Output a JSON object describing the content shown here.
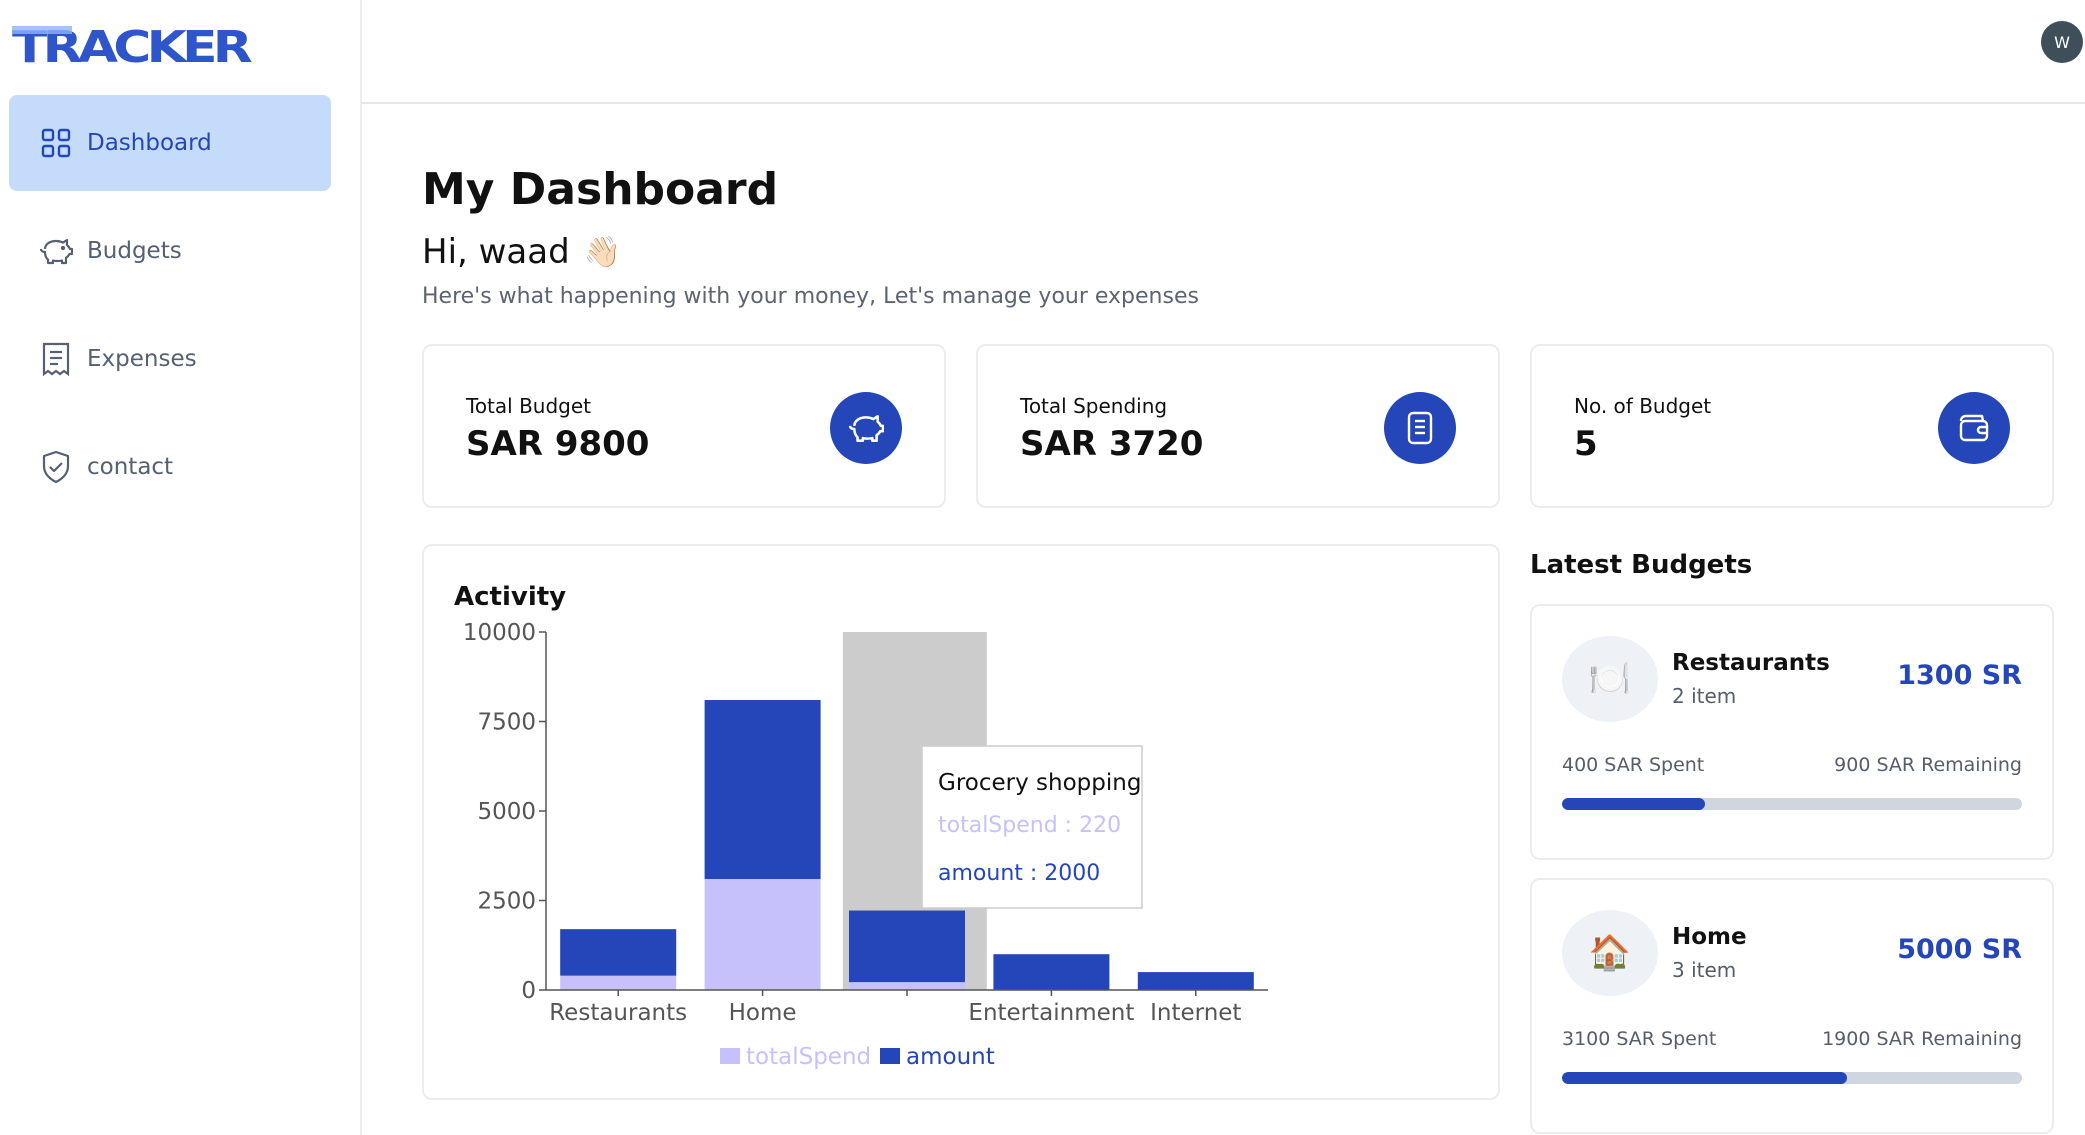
{
  "app": {
    "logo_text": "TRACKER"
  },
  "sidebar": {
    "items": [
      {
        "label": "Dashboard",
        "icon": "grid-icon",
        "active": true
      },
      {
        "label": "Budgets",
        "icon": "piggy-bank-icon",
        "active": false
      },
      {
        "label": "Expenses",
        "icon": "receipt-icon",
        "active": false
      },
      {
        "label": "contact",
        "icon": "shield-check-icon",
        "active": false
      }
    ]
  },
  "header": {
    "avatar_initial": "W"
  },
  "main": {
    "title": "My Dashboard",
    "greeting": "Hi, waad",
    "greeting_emoji": "👋🏻",
    "subtitle": "Here's what happening with your money, Let's manage your expenses"
  },
  "stats": [
    {
      "label": "Total Budget",
      "value": "SAR 9800",
      "icon": "piggy-bank-icon"
    },
    {
      "label": "Total Spending",
      "value": "SAR 3720",
      "icon": "receipt-icon"
    },
    {
      "label": "No. of Budget",
      "value": "5",
      "icon": "wallet-icon"
    }
  ],
  "activity": {
    "title": "Activity",
    "tooltip": {
      "title": "Grocery shopping",
      "total_spend": "totalSpend : 220",
      "amount": "amount : 2000"
    }
  },
  "chart_data": {
    "type": "bar",
    "stacked": true,
    "categories": [
      "Restaurants",
      "Home",
      "Grocery shopping",
      "Entertainment",
      "Internet"
    ],
    "x_tick_labels": [
      "Restaurants",
      "Home",
      "",
      "Entertainment",
      "Internet"
    ],
    "series": [
      {
        "name": "totalSpend",
        "color": "#c6c1fb",
        "values": [
          400,
          3100,
          220,
          0,
          0
        ]
      },
      {
        "name": "amount",
        "color": "#2446b8",
        "values": [
          1300,
          5000,
          2000,
          1000,
          500
        ]
      }
    ],
    "ylim": [
      0,
      10000
    ],
    "yticks": [
      "0",
      "2500",
      "5000",
      "7500",
      "10000"
    ],
    "highlighted_category": "Grocery shopping",
    "legend": "bottom-center"
  },
  "latest_budgets": {
    "title": "Latest Budgets",
    "items": [
      {
        "name": "Restaurants",
        "items": "2 item",
        "amount": "1300 SR",
        "spent": "400 SAR Spent",
        "remaining": "900 SAR Remaining",
        "progress": 0.31,
        "emoji": "🍽️"
      },
      {
        "name": "Home",
        "items": "3 item",
        "amount": "5000 SR",
        "spent": "3100 SAR Spent",
        "remaining": "1900 SAR Remaining",
        "progress": 0.62,
        "emoji": "🏠"
      }
    ]
  },
  "colors": {
    "accent": "#2446b8",
    "active_nav_bg": "#c4dbfb",
    "total_spend": "#c6c1fb",
    "hover_bg": "#cccccc"
  }
}
